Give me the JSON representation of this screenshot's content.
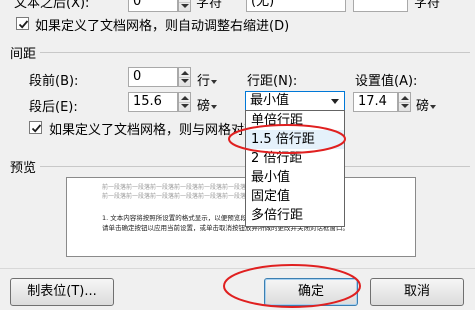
{
  "top": {
    "partial_row_left": "文本之后(X):",
    "partial_row_value": "0",
    "partial_row_unit": "字符",
    "partial_row_select": "(无)",
    "partial_row_unit2": "字符",
    "grid_right_indent_checkbox": "如果定义了文档网格，则自动调整右缩进(D)"
  },
  "spacing": {
    "section_title": "间距",
    "before_label": "段前(B):",
    "before_value": "0",
    "before_unit": "行",
    "after_label": "段后(E):",
    "after_value": "15.6",
    "after_unit": "磅",
    "line_spacing_label": "行距(N):",
    "line_spacing_value": "最小值",
    "setting_label": "设置值(A):",
    "setting_value": "17.4",
    "setting_unit": "磅",
    "snap_to_grid_checkbox": "如果定义了文档网格，则与网格对齐"
  },
  "dropdown": {
    "options": [
      "单倍行距",
      "1.5 倍行距",
      "2 倍行距",
      "最小值",
      "固定值",
      "多倍行距"
    ]
  },
  "preview": {
    "title": "预览",
    "sample_line_1": "前一段落前一段落前一段落前一段落前一段落前一段落前一段落前一段落前一段落",
    "sample_line_2": "前一段落前一段落前一段落前一段落前一段落前一段落前一段落前一段落前一段落",
    "sample_line_3": "1. 文本内容将按照所设置的格式显示，以便预览段落缩进与间距效果，确认后生效。",
    "sample_line_4": "请单击确定按钮以应用当前设置，或单击取消按钮放弃所做的更改并关闭对话框窗口。"
  },
  "buttons": {
    "tabs": "制表位(T)...",
    "ok": "确定",
    "cancel": "取消"
  },
  "colors": {
    "annotation_red": "#e02020",
    "selection_border": "#0078d7",
    "checkbox_check": "#1a1a1a"
  }
}
